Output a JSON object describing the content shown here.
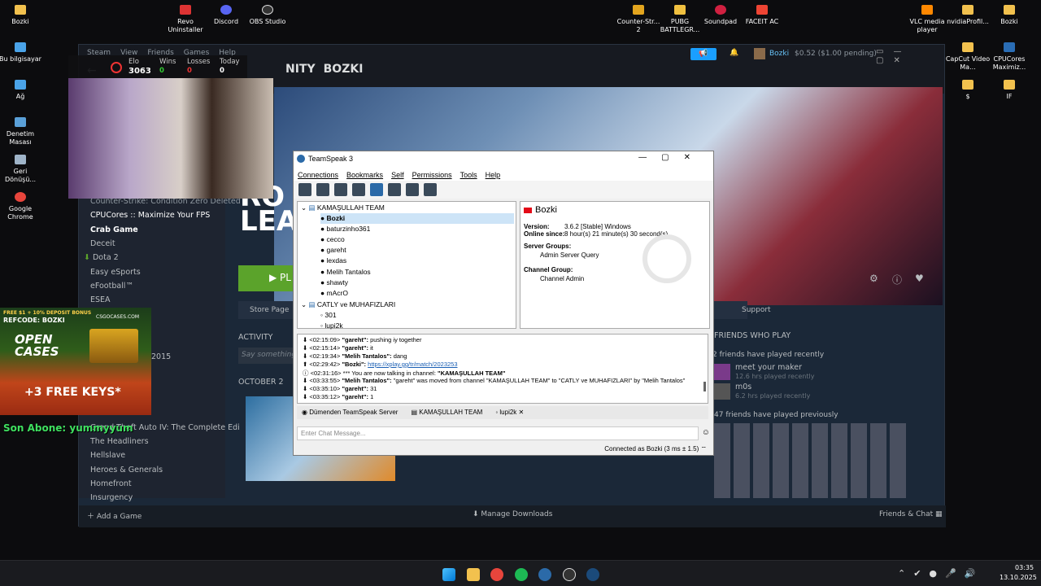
{
  "desktop": {
    "left": [
      {
        "label": "Bozki"
      },
      {
        "label": "Bu bilgisayar"
      },
      {
        "label": "Ağ"
      },
      {
        "label": "Denetim Masası"
      },
      {
        "label": "Geri Dönüşü..."
      },
      {
        "label": "Google Chrome"
      }
    ],
    "top": [
      {
        "label": "Revo Uninstaller"
      },
      {
        "label": "Discord"
      },
      {
        "label": "OBS Studio"
      },
      {
        "label": "Counter-Str... 2"
      },
      {
        "label": "PUBG BATTLEGR..."
      },
      {
        "label": "Soundpad"
      },
      {
        "label": "FACEIT AC"
      },
      {
        "label": "VLC media player"
      },
      {
        "label": "nvidiaProfil..."
      },
      {
        "label": "Bozki"
      }
    ],
    "right": [
      {
        "label": "CapCut Video Ma..."
      },
      {
        "label": "CPUCores Maximiz..."
      },
      {
        "label": "$"
      },
      {
        "label": "IF"
      }
    ]
  },
  "overlay": {
    "elo_label": "Elo",
    "elo": "3063",
    "wins_label": "Wins",
    "wins": "0",
    "losses_label": "Losses",
    "losses": "0",
    "today_label": "Today",
    "today": "0"
  },
  "steam": {
    "menu": [
      "Steam",
      "View",
      "Friends",
      "Games",
      "Help"
    ],
    "nav": [
      "NITY",
      "BOZKI"
    ],
    "user": "Bozki",
    "wallet": "$0.52 ($1.00 pending)",
    "sidebar": [
      "Counter-Strike: Condition Zero Deleted",
      "CPUCores :: Maximize Your FPS",
      "Crab Game",
      "Deceit",
      "Dota 2",
      "Easy eSports",
      "eFootball™",
      "ESEA",
      "2015",
      "Grand Theft Auto IV: The Complete Edi",
      "The Headliners",
      "Hellslave",
      "Heroes & Generals",
      "Homefront",
      "Insurgency"
    ],
    "store_page": "Store Page",
    "support": "Support",
    "activity": "ACTIVITY",
    "say_something": "Say something",
    "october": "OCTOBER 2",
    "friends_who_play": "FRIENDS WHO PLAY",
    "recent": "2 friends have played recently",
    "f1_name": "meet your maker",
    "f1_hrs": "12.6 hrs played recently",
    "f2_name": "m0s",
    "f2_hrs": "6.2 hrs played recently",
    "previously": "47 friends have played previously",
    "add_game": "Add a Game",
    "manage_downloads": "Manage Downloads",
    "friends_chat": "Friends & Chat"
  },
  "ad": {
    "line1": "FREE $1 + 10% DEPOSIT BONUS",
    "brand": "CSGOCASES.COM",
    "refcode": "REFCODE: BOZKI",
    "open": "OPEN",
    "cases": "CASES",
    "keys": "+3 FREE KEYS*"
  },
  "sub_text": "Son Abone: yummyyum",
  "ts": {
    "title": "TeamSpeak 3",
    "menu": [
      "Connections",
      "Bookmarks",
      "Self",
      "Permissions",
      "Tools",
      "Help"
    ],
    "channel1": "KAMAŞULLAH TEAM",
    "users1": [
      "Bozki",
      "baturzinho361",
      "cecco",
      "gareht",
      "lexdas",
      "Melih Tantalos",
      "shawty",
      "mAcrO"
    ],
    "channel2": "CATLY ve MUHAFIZLARI",
    "users2": [
      "301",
      "lupi2k"
    ],
    "info": {
      "name": "Bozki",
      "version_label": "Version:",
      "version": "3.6.2 [Stable] Windows",
      "online_label": "Online since:",
      "online": "8 hour(s) 21 minute(s) 30 second(s)",
      "sg_label": "Server Groups:",
      "sg": "Admin Server Query",
      "cg_label": "Channel Group:",
      "cg": "Channel Admin"
    },
    "chat": [
      {
        "t": "<02:15:09>",
        "u": "\"gareht\":",
        "m": "pushing iy together"
      },
      {
        "t": "<02:15:14>",
        "u": "\"gareht\":",
        "m": "it"
      },
      {
        "t": "<02:19:34>",
        "u": "\"Melih Tantalos\":",
        "m": "dang"
      },
      {
        "t": "<02:29:42>",
        "u": "\"Bozki\":",
        "m": "https://xplay.gg/tr/match/2023253"
      },
      {
        "t": "<02:31:16>",
        "u": "*** You are now talking in channel:",
        "m": "\"KAMAŞULLAH TEAM\""
      },
      {
        "t": "<03:33:55>",
        "u": "\"Melih Tantalos\":",
        "m": "\"gareht\" was moved from channel \"KAMAŞULLAH TEAM\" to \"CATLY ve MUHAFIZLARI\" by \"Melih Tantalos\""
      },
      {
        "t": "<03:35:10>",
        "u": "\"gareht\":",
        "m": "31"
      },
      {
        "t": "<03:35:12>",
        "u": "\"gareht\":",
        "m": "1"
      }
    ],
    "tabs": [
      "Dümenden TeamSpeak Server",
      "KAMAŞULLAH TEAM",
      "lupi2k"
    ],
    "input_placeholder": "Enter Chat Message...",
    "status": "Connected as Bozki (3 ms ± 1.5)"
  },
  "taskbar": {
    "time": "03:35",
    "date": "13.10.2025"
  }
}
